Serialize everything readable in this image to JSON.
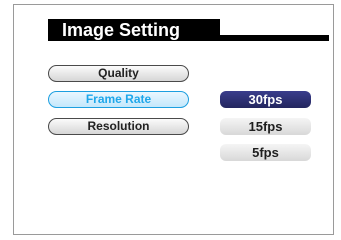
{
  "title": "Image Setting",
  "menu": {
    "items": [
      {
        "label": "Quality"
      },
      {
        "label": "Frame Rate"
      },
      {
        "label": "Resolution"
      }
    ],
    "selected": "Frame Rate"
  },
  "options": {
    "items": [
      {
        "label": "30fps"
      },
      {
        "label": "15fps"
      },
      {
        "label": "5fps"
      }
    ],
    "selected": "30fps"
  },
  "colors": {
    "title_bar": "#000000",
    "selected_menu_text": "#1fa7ea",
    "selected_option_bg": "#2b2e70"
  }
}
